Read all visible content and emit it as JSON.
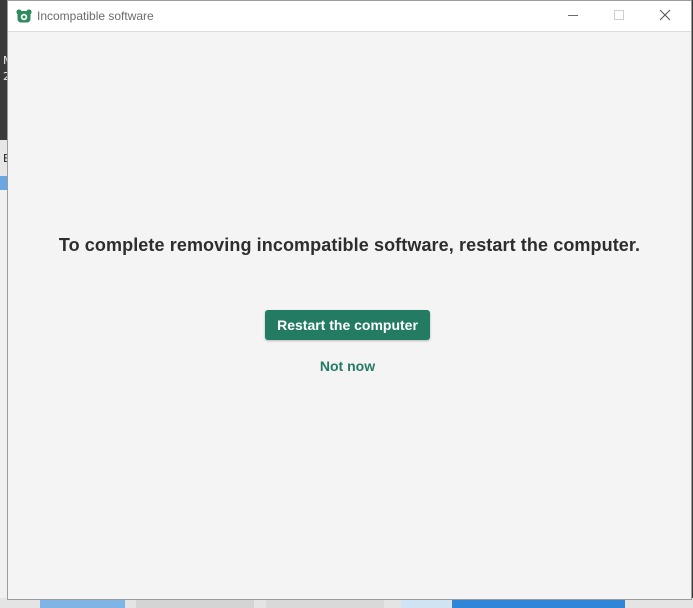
{
  "window": {
    "title": "Incompatible software",
    "controls": {
      "minimize_icon": "minimize-icon",
      "maximize_icon": "maximize-icon",
      "close_icon": "close-icon"
    }
  },
  "dialog": {
    "message": "To complete removing incompatible software, restart the computer.",
    "primary_button": "Restart the computer",
    "secondary_button": "Not now"
  },
  "background": {
    "fragment_1": "M",
    "fragment_2": "2",
    "fragment_3": "E"
  },
  "colors": {
    "accent": "#237b63",
    "window_bg": "#f4f4f4",
    "text": "#2d2d2d"
  }
}
